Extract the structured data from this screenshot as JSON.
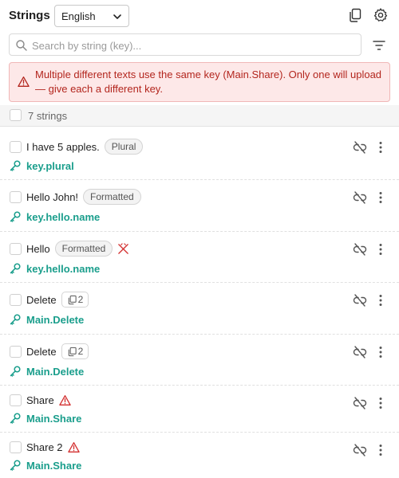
{
  "header": {
    "title": "Strings",
    "language": "English",
    "copy_icon": "copy-icon",
    "settings_icon": "gear-icon"
  },
  "search": {
    "placeholder": "Search by string (key)...",
    "value": "",
    "filter_icon": "filter-icon"
  },
  "alert": {
    "icon": "warning-icon",
    "message": "Multiple different texts use the same key (Main.Share). Only one will upload — give each a different key.",
    "color": "#b3261e",
    "background": "#fde8e8"
  },
  "summary": {
    "count_label": "7 strings"
  },
  "colors": {
    "key": "#1a9e8c",
    "warning": "#d32f2f"
  },
  "strings": [
    {
      "text": "I have 5 apples.",
      "badge": "Plural",
      "badge_type": "pill",
      "key": "key.plural"
    },
    {
      "text": "Hello John!",
      "badge": "Formatted",
      "badge_type": "pill",
      "key": "key.hello.name"
    },
    {
      "text": "Hello",
      "badge": "Formatted",
      "badge_type": "pill",
      "extra_icon": "broken-link-icon",
      "key": "key.hello.name"
    },
    {
      "text": "Delete",
      "badge": "2",
      "badge_type": "copies",
      "key": "Main.Delete"
    },
    {
      "text": "Delete",
      "badge": "2",
      "badge_type": "copies",
      "key": "Main.Delete"
    },
    {
      "text": "Share",
      "extra_icon": "warning-icon",
      "key": "Main.Share"
    },
    {
      "text": "Share 2",
      "extra_icon": "warning-icon",
      "key": "Main.Share"
    }
  ]
}
